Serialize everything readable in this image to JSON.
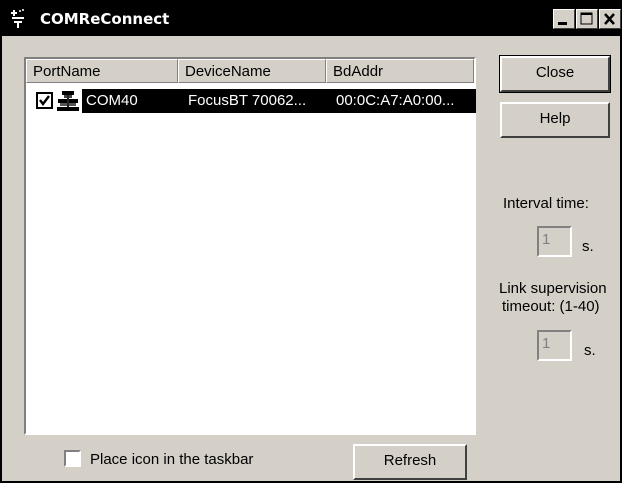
{
  "window": {
    "title": "COMReConnect"
  },
  "icons": {
    "app": "bluetooth-app-icon",
    "minimize": "minimize-icon",
    "maximize": "maximize-icon",
    "close": "close-icon",
    "device": "serial-port-icon",
    "check": "checkmark-icon"
  },
  "list": {
    "columns": [
      "PortName",
      "DeviceName",
      "BdAddr"
    ],
    "rows": [
      {
        "checked": true,
        "port": "COM40",
        "device": "FocusBT 70062...",
        "bdaddr": "00:0C:A7:A0:00..."
      }
    ]
  },
  "buttons": {
    "close": "Close",
    "help": "Help",
    "refresh": "Refresh"
  },
  "settings": {
    "interval_label": "Interval time:",
    "interval_value": "1",
    "interval_unit": "s.",
    "link_label_line1": "Link supervision",
    "link_label_line2": "timeout: (1-40)",
    "link_value": "1",
    "link_unit": "s."
  },
  "taskbar": {
    "label": "Place icon in the taskbar",
    "checked": false
  },
  "colors": {
    "face": "#d4d0c8",
    "titlebar": "#000000",
    "selection": "#000000"
  }
}
